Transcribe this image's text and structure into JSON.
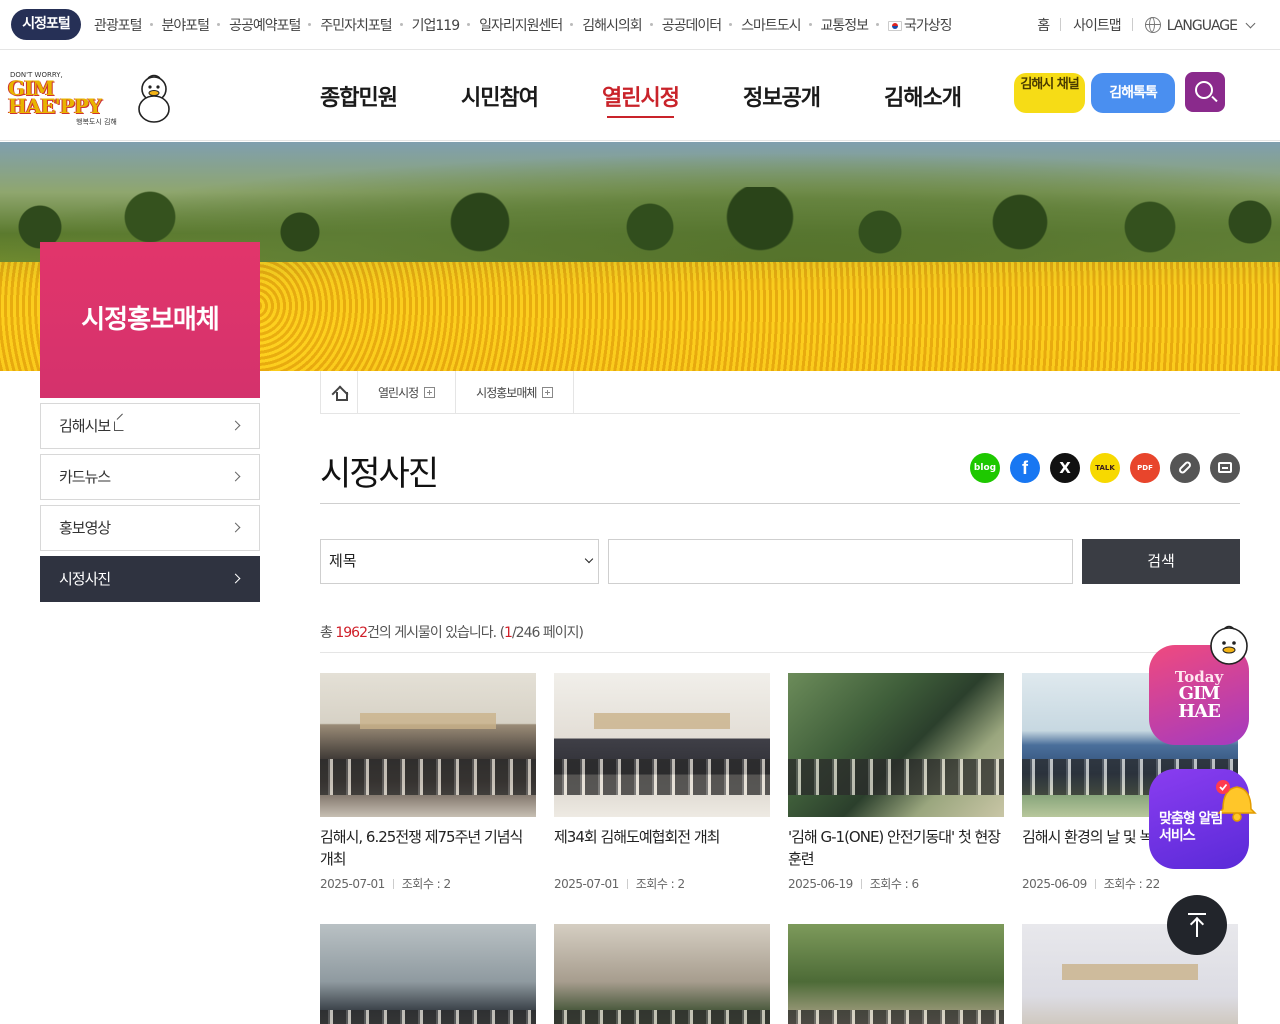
{
  "topbar": {
    "badge": "시정포털",
    "portals": [
      "관광포털",
      "분야포털",
      "공공예약포털",
      "주민자치포털",
      "기업119",
      "일자리지원센터",
      "김해시의회",
      "공공데이터",
      "스마트도시",
      "교통정보",
      "국가상징"
    ],
    "home": "홈",
    "sitemap": "사이트맵",
    "language": "LANGUAGE"
  },
  "logo": {
    "small": "DON'T WORRY,",
    "main_line1": "GIM",
    "main_line2": "HAE'PPY",
    "sub": "행복도시 김해"
  },
  "nav": {
    "items": [
      "종합민원",
      "시민참여",
      "열린시정",
      "정보공개",
      "김해소개"
    ],
    "active_index": 2,
    "channel_button": "김해시 채널",
    "talk_button": "김해톡톡",
    "search_icon": "search-icon"
  },
  "sidebar": {
    "title": "시정홍보매체",
    "items": [
      {
        "label": "김해시보",
        "external": true
      },
      {
        "label": "카드뉴스"
      },
      {
        "label": "홍보영상"
      },
      {
        "label": "시정사진",
        "active": true
      }
    ]
  },
  "breadcrumb": {
    "level1": "열린시정",
    "level2": "시정홍보매체"
  },
  "page": {
    "title": "시정사진"
  },
  "share": {
    "blog": "blog",
    "facebook": "f",
    "x": "X",
    "talk": "TALK",
    "pdf": "PDF"
  },
  "search": {
    "select_value": "제목",
    "input_value": "",
    "button": "검색"
  },
  "count": {
    "prefix": "총 ",
    "total": "1962",
    "middle": "건의 게시물이 있습니다. (",
    "page": "1",
    "suffix": "/246 페이지)"
  },
  "gallery": {
    "views_label": "조회수 : ",
    "cards": [
      {
        "title": "김해시, 6.25전쟁 제75주년 기념식 개최",
        "date": "2025-07-01",
        "views": "2"
      },
      {
        "title": "제34회 김해도예협회전 개최",
        "date": "2025-07-01",
        "views": "2"
      },
      {
        "title": "'김해 G-1(ONE) 안전기동대' 첫 현장 훈련",
        "date": "2025-06-19",
        "views": "6"
      },
      {
        "title": "김해시 환경의 날 및 녹색 기념행사",
        "date": "2025-06-09",
        "views": "22"
      },
      {
        "title": "",
        "date": "",
        "views": ""
      },
      {
        "title": "",
        "date": "",
        "views": ""
      },
      {
        "title": "",
        "date": "",
        "views": ""
      },
      {
        "title": "",
        "date": "",
        "views": ""
      }
    ]
  },
  "floating": {
    "today_label": "Today",
    "today_line1": "GIM",
    "today_line2": "HAE",
    "alert_label": "맞춤형 알림 서비스"
  },
  "colors": {
    "brand_navy": "#263056",
    "accent_red": "#c9232a",
    "sidebar_pink": "#d4326c",
    "active_dark": "#2f3340"
  }
}
